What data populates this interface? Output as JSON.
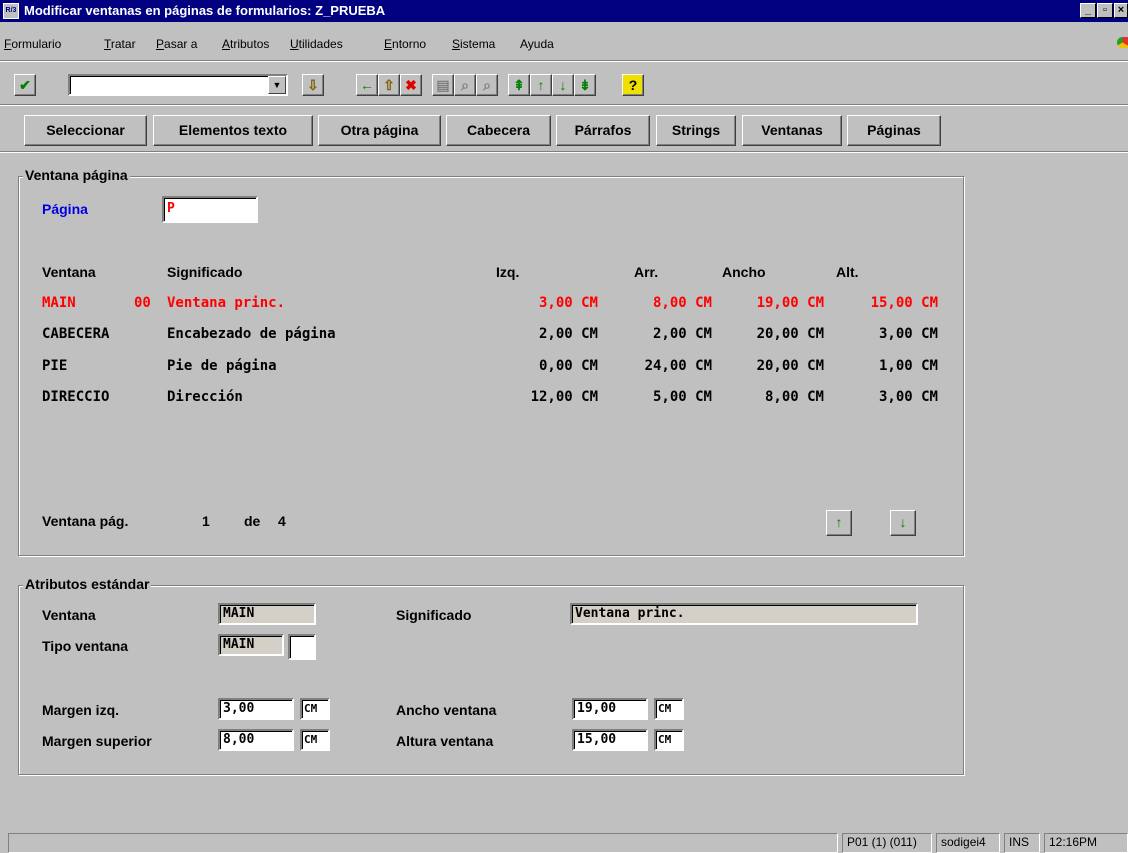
{
  "window": {
    "title": "Modificar ventanas en páginas de formularios: Z_PRUEBA",
    "app_icon": "R/3",
    "minimize_icon": "_",
    "maximize_icon": "▫",
    "close_icon": "×"
  },
  "menu": [
    {
      "ul": "F",
      "rest": "ormulario"
    },
    {
      "ul": "T",
      "rest": "ratar"
    },
    {
      "ul": "P",
      "rest": "asar a"
    },
    {
      "ul": "A",
      "rest": "tributos"
    },
    {
      "ul": "U",
      "rest": "tilidades"
    },
    {
      "ul": "E",
      "rest": "ntorno"
    },
    {
      "ul": "S",
      "rest": "istema"
    },
    {
      "ul": "",
      "rest": "Ayuda"
    }
  ],
  "toolbar": {
    "enter_icon": "✔",
    "command_value": "",
    "dropdown_icon": "▼",
    "save_icon": "⇩",
    "back_icon": "←",
    "exit_icon": "⇧",
    "cancel_icon": "✖",
    "print_icon": "▤",
    "find_icon": "⌕",
    "find_next_icon": "⌕",
    "first_page_icon": "⇞",
    "prev_page_icon": "↑",
    "next_page_icon": "↓",
    "last_page_icon": "⇟",
    "help_icon": "?"
  },
  "app_buttons": [
    "Seleccionar",
    "Elementos texto",
    "Otra página",
    "Cabecera",
    "Párrafos",
    "Strings",
    "Ventanas",
    "Páginas"
  ],
  "page_window": {
    "group_title": "Ventana página",
    "page_label": "Página",
    "page_value": "P",
    "headers": {
      "window": "Ventana",
      "meaning": "Significado",
      "left": "Izq.",
      "top": "Arr.",
      "width": "Ancho",
      "height": "Alt."
    },
    "rows": [
      {
        "window": "MAIN",
        "num": "00",
        "meaning": "Ventana princ.",
        "left": "3,00 CM",
        "top": "8,00 CM",
        "width": "19,00 CM",
        "height": "15,00 CM",
        "highlight": true
      },
      {
        "window": "CABECERA",
        "num": "",
        "meaning": "Encabezado de página",
        "left": "2,00 CM",
        "top": "2,00 CM",
        "width": "20,00 CM",
        "height": "3,00 CM",
        "highlight": false
      },
      {
        "window": "PIE",
        "num": "",
        "meaning": "Pie de página",
        "left": "0,00 CM",
        "top": "24,00 CM",
        "width": "20,00 CM",
        "height": "1,00 CM",
        "highlight": false
      },
      {
        "window": "DIRECCIO",
        "num": "",
        "meaning": "Dirección",
        "left": "12,00 CM",
        "top": "5,00 CM",
        "width": "8,00 CM",
        "height": "3,00 CM",
        "highlight": false
      }
    ],
    "pager_label": "Ventana pág.",
    "pager_current": "1",
    "pager_of": "de",
    "pager_total": "4",
    "scroll_up_icon": "↑",
    "scroll_down_icon": "↓"
  },
  "std_attrs": {
    "group_title": "Atributos estándar",
    "window_label": "Ventana",
    "window_value": "MAIN",
    "meaning_label": "Significado",
    "meaning_value": "Ventana princ.",
    "type_label": "Tipo ventana",
    "type_value": "MAIN",
    "type_extra": "",
    "margin_left_label": "Margen izq.",
    "margin_left_value": "3,00",
    "margin_left_unit": "CM",
    "margin_top_label": "Margen superior",
    "margin_top_value": "8,00",
    "margin_top_unit": "CM",
    "width_label": "Ancho ventana",
    "width_value": "19,00",
    "width_unit": "CM",
    "height_label": "Altura ventana",
    "height_value": "15,00",
    "height_unit": "CM"
  },
  "statusbar": {
    "message": "",
    "system": "P01 (1) (011)",
    "server": "sodigei4",
    "mode": "INS",
    "time": "12:16PM"
  },
  "colors": {
    "title_bg": "#000080",
    "highlight": "#ff0000",
    "label_blue": "#0000e0",
    "face": "#c0c0c0"
  }
}
